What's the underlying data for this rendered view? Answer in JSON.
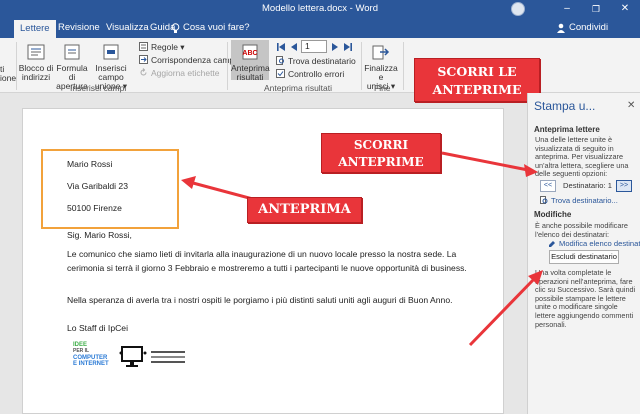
{
  "titlebar": {
    "title": "Modello lettera.docx  -  Word",
    "minimize": "–",
    "restore": "❐",
    "close": "✕"
  },
  "tabs": [
    {
      "label": "Lettere",
      "active": true
    },
    {
      "label": "Revisione",
      "active": false
    },
    {
      "label": "Visualizza",
      "active": false
    },
    {
      "label": "Guida",
      "active": false
    }
  ],
  "tellme": "Cosa vuoi fare?",
  "share": "Condividi",
  "ribbon": {
    "cut_left_1": "ti",
    "cut_left_2": "ione",
    "blocco": [
      "Blocco di",
      "indirizzi"
    ],
    "formula": [
      "Formula di",
      "apertura"
    ],
    "inserisci": [
      "Inserisci campo",
      "unione"
    ],
    "regole": "Regole",
    "corrispondenza": "Corrispondenza campi",
    "aggiorna": "Aggiorna etichette",
    "group_campi": "Inserisci campi",
    "anteprima": [
      "Anteprima",
      "risultati"
    ],
    "record": "1",
    "trova": "Trova destinatario",
    "controllo": "Controllo errori",
    "group_anteprima": "Anteprima risultati",
    "finalizza": [
      "Finalizza e",
      "unisci"
    ],
    "group_fine": "Fine"
  },
  "letter": {
    "addr1": "Mario Rossi",
    "addr2": "Via Garibaldi 23",
    "addr3": "50100 Firenze",
    "greeting": "Sig. Mario Rossi,",
    "p1a": "Le comunico che siamo lieti di invitarla alla inaugurazione di un nuovo locale presso la nostra sede. La",
    "p1b": "cerimonia si terrà il giorno 3 Febbraio e mostreremo a tutti i partecipanti le nuove opportunità di business.",
    "p2": "Nella speranza di averla tra i nostri ospiti le porgiamo i più distinti saluti uniti agli auguri di Buon Anno.",
    "sign": "Lo Staff di IpCei",
    "logo1": [
      "IDEE",
      "PER IL",
      "COMPUTER",
      "E INTERNET"
    ]
  },
  "callouts": {
    "top_right": [
      "SCORRI LE",
      "ANTEPRIME"
    ],
    "middle": [
      "SCORRI",
      "ANTEPRIME"
    ],
    "anteprima": "ANTEPRIMA"
  },
  "pane": {
    "title": "Stampa u...",
    "close": "✕",
    "h1": "Anteprima lettere",
    "t1": "Una delle lettere unite è visualizzata di seguito in anteprima. Per visualizzare un'altra lettera, scegliere una delle seguenti opzioni:",
    "prev": "<<",
    "next": ">>",
    "dest": "Destinatario: 1",
    "trova": "Trova destinatario...",
    "h2": "Modifiche",
    "t2": "È anche possibile modificare l'elenco dei destinatari:",
    "modifica": "Modifica elenco destinatari",
    "escludi": "Escludi destinatario",
    "t3": "Una volta completate le operazioni nell'anteprima, fare clic su Successivo. Sarà quindi possibile stampare le lettere unite o modificare singole lettere aggiungendo commenti personali."
  },
  "colors": {
    "word_blue": "#2b579a",
    "callout_red": "#e9353a",
    "box_orange": "#f2a23b"
  }
}
